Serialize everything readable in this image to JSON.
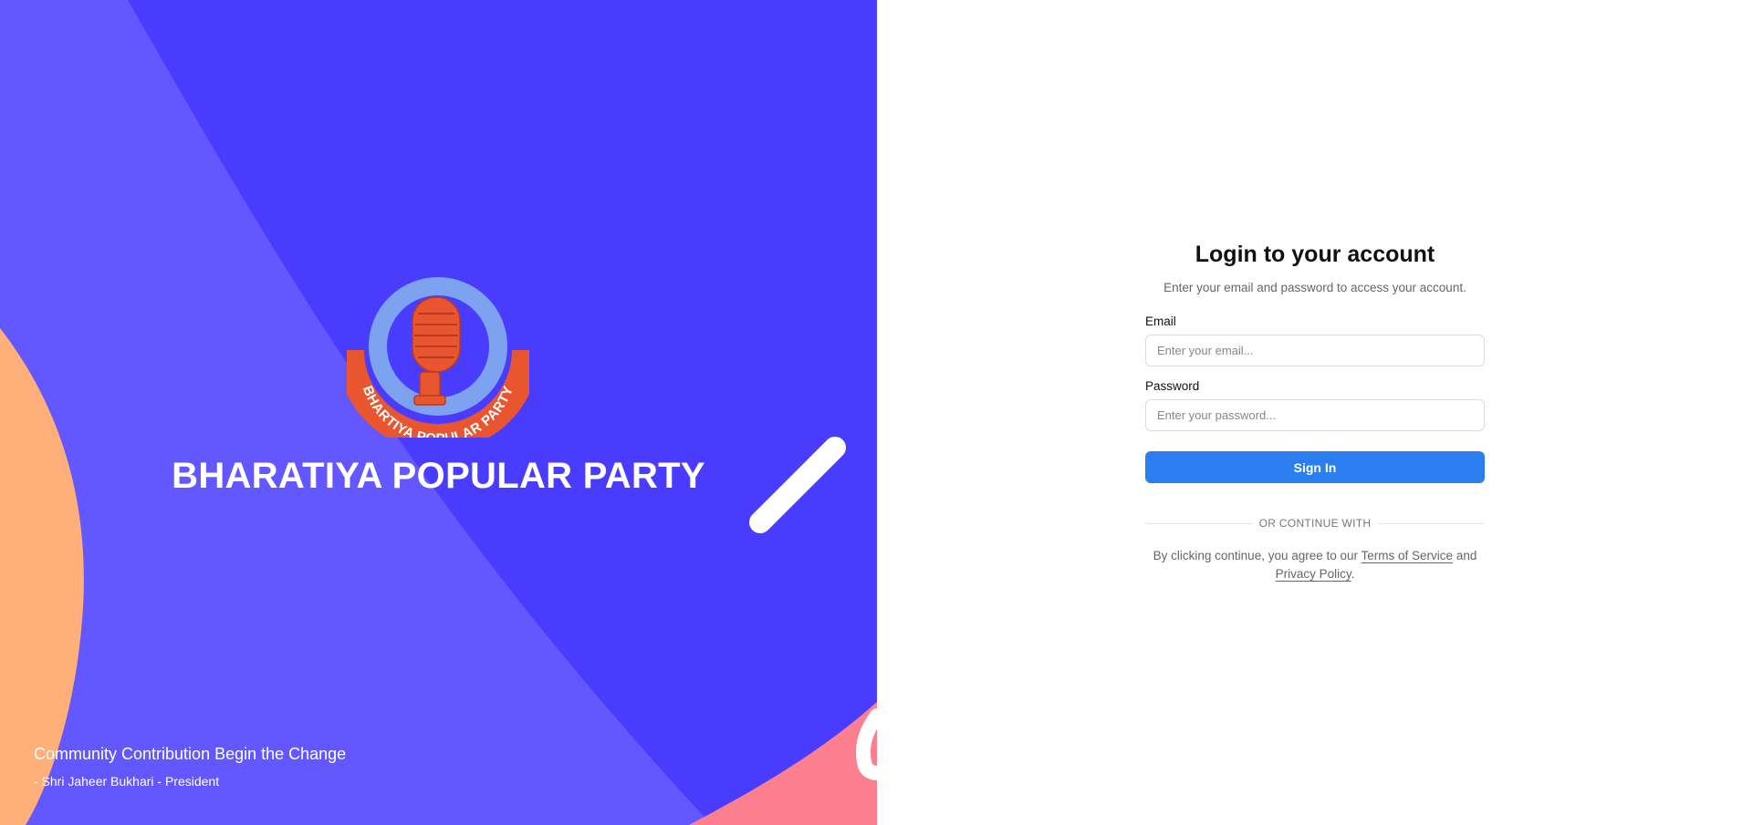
{
  "brand": {
    "name": "BHARATIYA POPULAR PARTY",
    "logo_text": "BHARTIYA POPULAR PARTY",
    "colors": {
      "primary_bg": "#4a3cff",
      "secondary_bg": "#6358ff",
      "orange_accent": "#ffb07a",
      "pink_accent": "#fb7f8e",
      "logo_ring": "#7da2ef",
      "logo_orange": "#e8552f"
    }
  },
  "hero": {
    "quote": "Community Contribution Begin the Change",
    "quote_author": "- Shri Jaheer Bukhari - President"
  },
  "login": {
    "title": "Login to your account",
    "subtitle": "Enter your email and password to access your account.",
    "email_label": "Email",
    "email_placeholder": "Enter your email...",
    "password_label": "Password",
    "password_placeholder": "Enter your password...",
    "signin_label": "Sign In",
    "divider_text": "OR CONTINUE WITH",
    "terms_prefix": "By clicking continue, you agree to our ",
    "terms_link": "Terms of Service",
    "terms_middle": " and ",
    "privacy_link": "Privacy Policy",
    "terms_suffix": ".",
    "button_color": "#2a7ef0"
  }
}
